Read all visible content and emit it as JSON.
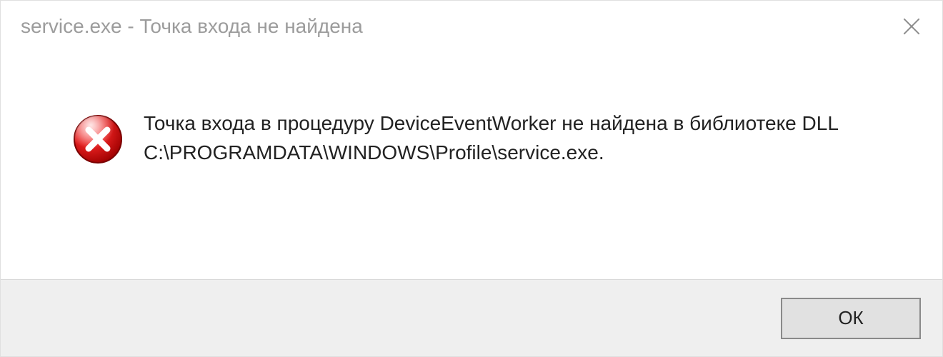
{
  "titlebar": {
    "title": "service.exe - Точка входа не найдена"
  },
  "content": {
    "message": "Точка входа в процедуру DeviceEventWorker не найдена в библиотеке DLL C:\\PROGRAMDATA\\WINDOWS\\Profile\\service.exe."
  },
  "buttons": {
    "ok_label": "ОК"
  },
  "icons": {
    "error": "error-icon",
    "close": "close-icon"
  }
}
